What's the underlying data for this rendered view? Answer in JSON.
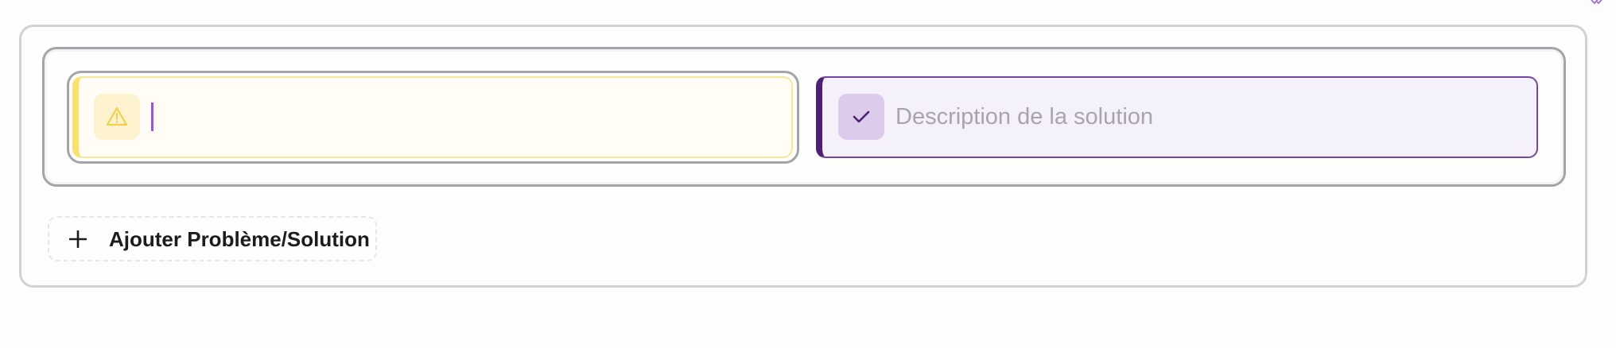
{
  "icons": {
    "corner": "double-check-icon",
    "problem": "warning-triangle-icon",
    "solution": "check-icon",
    "add": "plus-icon"
  },
  "colors": {
    "problem_accent": "#fce167",
    "problem_background": "#fffdf6",
    "solution_accent": "#4b2176",
    "solution_background": "#f5f1fb",
    "caret": "#a24fe0"
  },
  "problem": {
    "value": ""
  },
  "solution": {
    "value": "",
    "placeholder": "Description de la solution"
  },
  "actions": {
    "add_label": "Ajouter Problème/Solution"
  }
}
